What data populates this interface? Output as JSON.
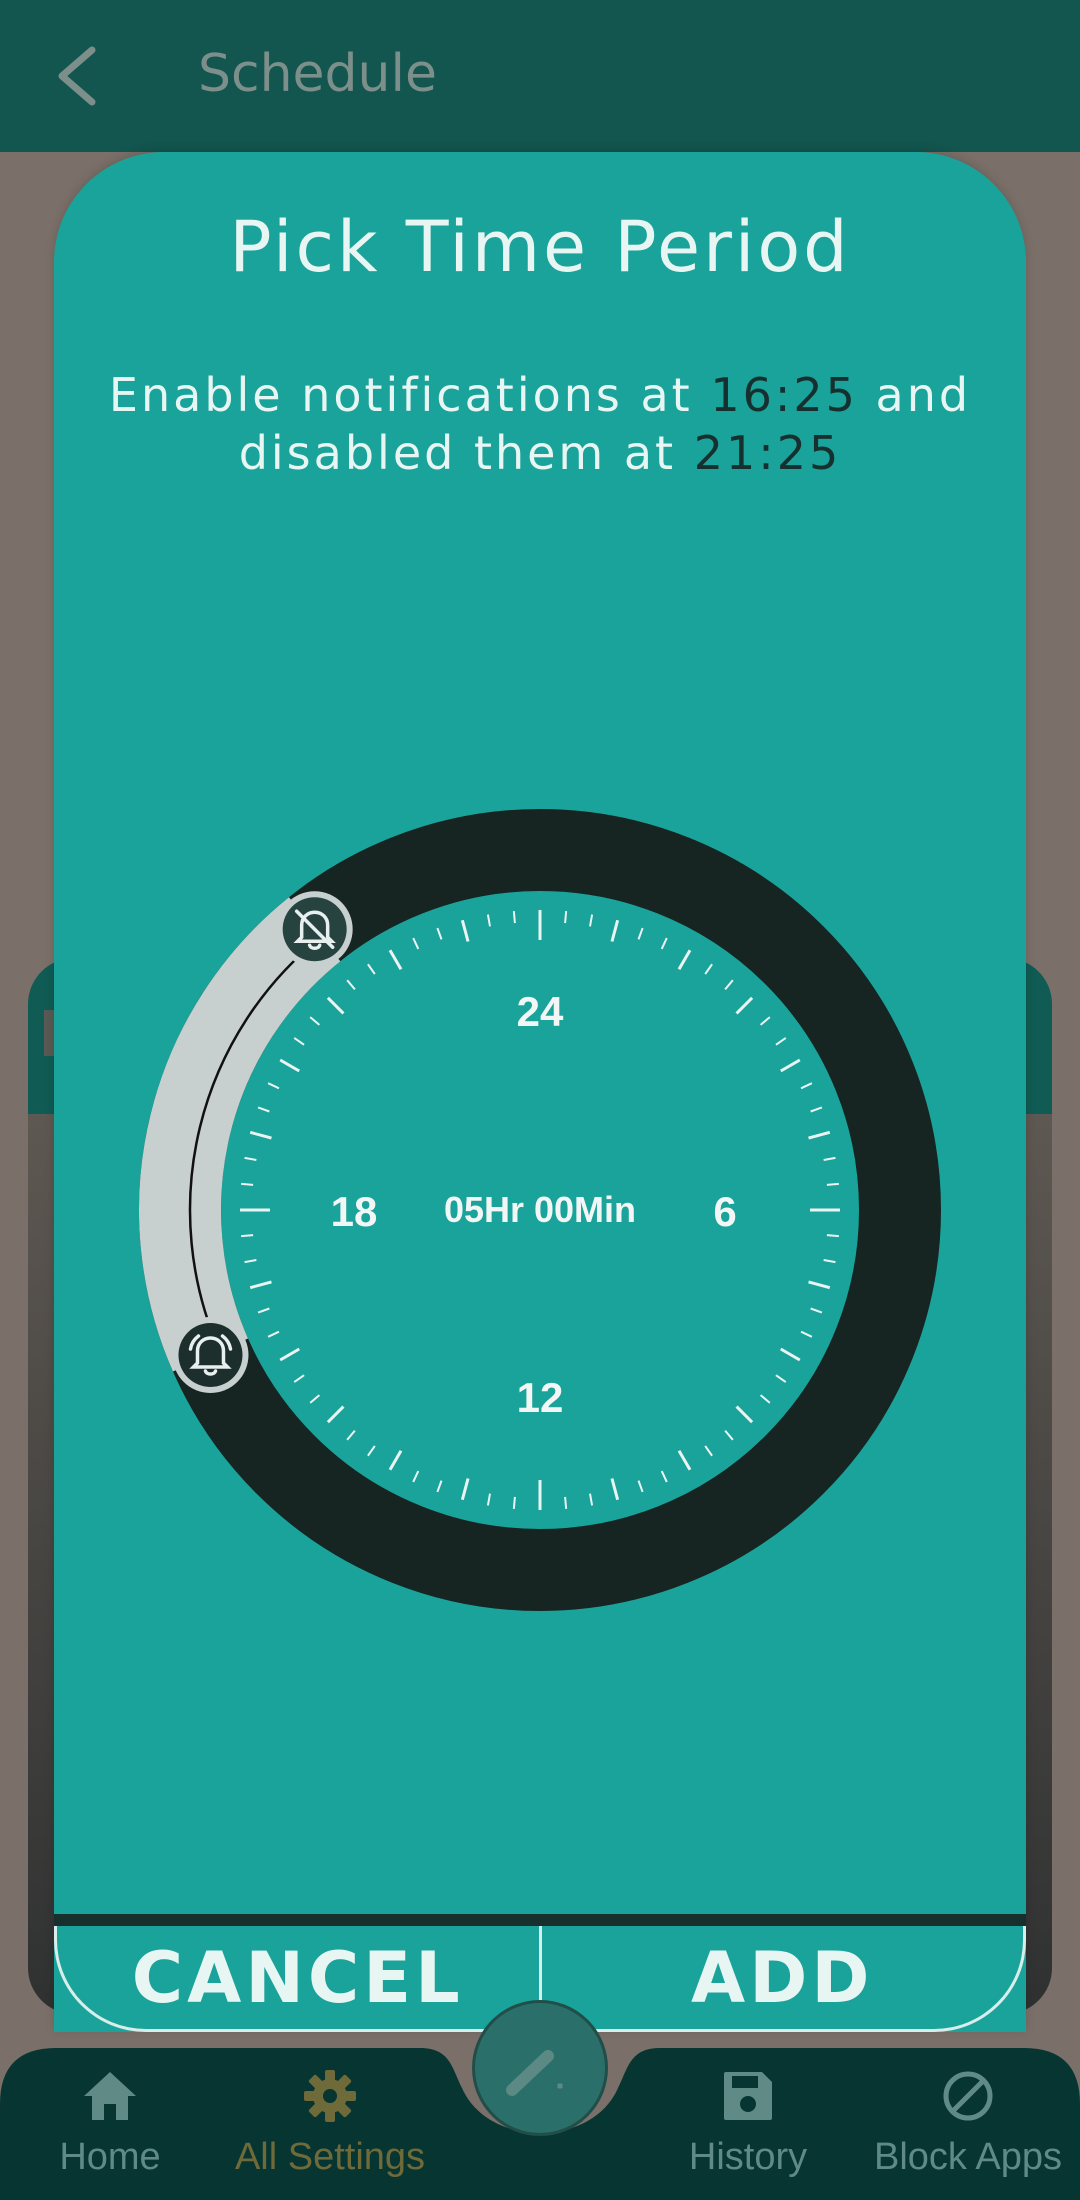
{
  "appbar": {
    "title": "Schedule",
    "back_icon": "chevron-left-icon"
  },
  "dialog": {
    "title": "Pick Time Period",
    "summary": {
      "prefix": "Enable notifications at",
      "start_time": "16:25",
      "middle": "and",
      "line2_prefix": "disabled them at",
      "end_time": "21:25"
    },
    "dial": {
      "labels": {
        "top": "24",
        "right": "6",
        "bottom": "12",
        "left": "18"
      },
      "duration": "05Hr 00Min",
      "start_handle_icon": "bell-icon",
      "end_handle_icon": "bell-off-icon"
    },
    "buttons": {
      "cancel": "CANCEL",
      "add": "ADD"
    }
  },
  "nav": {
    "items": [
      {
        "label": "Home",
        "icon": "home-icon"
      },
      {
        "label": "All Settings",
        "icon": "gear-icon"
      },
      {
        "label": "History",
        "icon": "save-icon"
      },
      {
        "label": "Block Apps",
        "icon": "block-icon"
      }
    ],
    "active_index": 1,
    "fab_icon": "magic-wand-icon"
  },
  "colors": {
    "dialog_bg": "#1aa39a",
    "ring": "#162422",
    "selected_arc": "#c8d0cf",
    "appbar": "#12564f"
  }
}
